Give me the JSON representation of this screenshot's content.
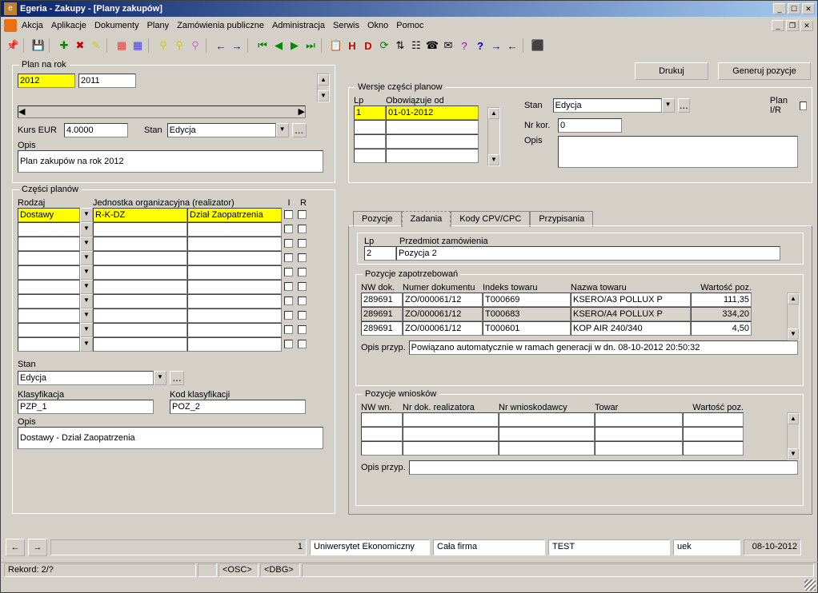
{
  "window": {
    "title": "Egeria - Zakupy - [Plany zakupów]",
    "menus": [
      "Akcja",
      "Aplikacje",
      "Dokumenty",
      "Plany",
      "Zamówienia publiczne",
      "Administracja",
      "Serwis",
      "Okno",
      "Pomoc"
    ]
  },
  "topbuttons": {
    "print": "Drukuj",
    "generate": "Generuj pozycje"
  },
  "plan": {
    "legend": "Plan na rok",
    "year_from": "2012",
    "year_to": "2011",
    "kurs_label": "Kurs EUR",
    "kurs": "4.0000",
    "stan_label": "Stan",
    "stan": "Edycja",
    "opis_label": "Opis",
    "opis": "Plan zakupów na rok 2012"
  },
  "versions": {
    "legend": "Wersje części planow",
    "lp_header": "Lp",
    "date_header": "Obowiązuje od",
    "lp": "1",
    "date": "01-01-2012",
    "stan_label": "Stan",
    "stan": "Edycja",
    "nrkor_label": "Nr kor.",
    "nrkor": "0",
    "opis_label": "Opis",
    "planir_label": "Plan I/R"
  },
  "parts": {
    "legend": "Części planów",
    "h_rodzaj": "Rodzaj",
    "h_jedn": "Jednostka organizacyjna (realizator)",
    "h_i": "I",
    "h_r": "R",
    "row_rodzaj": "Dostawy",
    "row_code": "R-K-DZ",
    "row_dept": "Dział Zaopatrzenia",
    "stan_label": "Stan",
    "stan": "Edycja",
    "klas_label": "Klasyfikacja",
    "klas": "PZP_1",
    "kodklas_label": "Kod klasyfikacji",
    "kodklas": "POZ_2",
    "opis_label": "Opis",
    "opis": "Dostawy - Dział Zaopatrzenia"
  },
  "tabs": {
    "pozycje": "Pozycje",
    "zadania": "Zadania",
    "kody": "Kody CPV/CPC",
    "przypisania": "Przypisania"
  },
  "pos_header": {
    "lp_label": "Lp",
    "przedmiot_label": "Przedmiot zamówienia",
    "lp": "2",
    "przedmiot": "Pozycja 2"
  },
  "zapotrzebowan": {
    "legend": "Pozycje zapotrzebowań",
    "h_nwdok": "NW dok.",
    "h_numer": "Numer dokumentu",
    "h_indeks": "Indeks towaru",
    "h_nazwa": "Nazwa towaru",
    "h_wartosc": "Wartość poz.",
    "rows": [
      {
        "nwdok": "289691",
        "numer": "ZO/000061/12",
        "indeks": "T000669",
        "nazwa": "KSERO/A3 POLLUX P",
        "wartosc": "111,35"
      },
      {
        "nwdok": "289691",
        "numer": "ZO/000061/12",
        "indeks": "T000683",
        "nazwa": "KSERO/A4 POLLUX P",
        "wartosc": "334,20"
      },
      {
        "nwdok": "289691",
        "numer": "ZO/000061/12",
        "indeks": "T000601",
        "nazwa": "KOP AIR 240/340",
        "wartosc": "4,50"
      }
    ],
    "opis_label": "Opis przyp.",
    "opis": "Powiązano automatycznie w ramach generacji w dn. 08-10-2012 20:50:32"
  },
  "wnioskow": {
    "legend": "Pozycje wniosków",
    "h_nwwn": "NW wn.",
    "h_nrdok": "Nr dok. realizatora",
    "h_nrwn": "Nr wnioskodawcy",
    "h_towar": "Towar",
    "h_wartosc": "Wartość poz.",
    "opis_label": "Opis przyp."
  },
  "status": {
    "num": "1",
    "uni": "Uniwersytet Ekonomiczny",
    "scope": "Cała firma",
    "env": "TEST",
    "user": "uek",
    "date": "08-10-2012"
  },
  "bottom": {
    "rekord": "Rekord: 2/?",
    "osc": "<OSC>",
    "dbg": "<DBG>"
  }
}
